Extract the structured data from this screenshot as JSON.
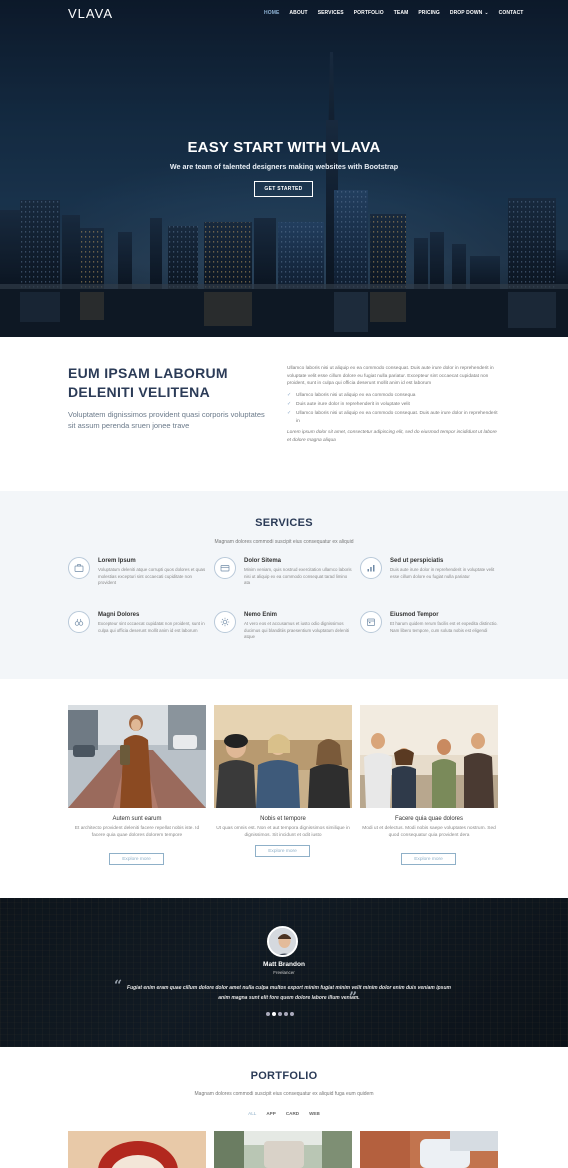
{
  "nav": {
    "logo": "VLAVA",
    "items": [
      "HOME",
      "ABOUT",
      "SERVICES",
      "PORTFOLIO",
      "TEAM",
      "PRICING",
      "DROP DOWN",
      "CONTACT"
    ],
    "active": "HOME"
  },
  "hero": {
    "title": "EASY START WITH VLAVA",
    "subtitle": "We are team of talented designers making websites with Bootstrap",
    "button": "GET STARTED"
  },
  "about": {
    "title": "EUM IPSAM LABORUM DELENITI VELITENA",
    "lead": "Voluptatem dignissimos provident quasi corporis voluptates sit assum perenda sruen jonee trave",
    "paragraph": "Ullamco laboris nisi ut aliquip ex ea commodo consequat. Duis aute irure dolor in reprehenderit in voluptate velit esse cillum dolore eu fugiat nulla pariatur. Excepteur sint occaecat cupidatat non proident, sunt in culpa qui officia deserunt mollit anim id est laborum",
    "checklist": [
      "Ullamco laboris nisi ut aliquip ex ea commodo consequa",
      "Duis aute irure dolor in reprehenderit in voluptate velit",
      "Ullamco laboris nisi ut aliquip ex ea commodo consequat. Duis aute irure dolor in reprehenderit in"
    ],
    "italic": "Lorem ipsum dolor sit amet, consectetur adipiscing elit, sed do eiusmod tempor incididunt ut labore et dolore magna aliqua"
  },
  "services": {
    "title": "SERVICES",
    "subtitle": "Magnam dolores commodi suscipit eius consequatur ex aliquid",
    "items": [
      {
        "name": "Lorem Ipsum",
        "desc": "Voluptatum deleniti atque corrupti quos dolores et quas molestias excepturi sint occaecati cupiditate non provident",
        "icon": "briefcase-icon"
      },
      {
        "name": "Dolor Sitema",
        "desc": "Minim veniam, quis nostrud exercitation ullamco laboris nisi ut aliquip ex ea commodo consequat tarad limino ata",
        "icon": "card-icon"
      },
      {
        "name": "Sed ut perspiciatis",
        "desc": "Duis aute irure dolor in reprehenderit in voluptate velit esse cillum dolore eu fugiat nulla pariatur",
        "icon": "bar-chart-icon"
      },
      {
        "name": "Magni Dolores",
        "desc": "Excepteur sint occaecat cupidatat non proident, sunt in culpa qui officia deserunt mollit anim id est laborum",
        "icon": "binoculars-icon"
      },
      {
        "name": "Nemo Enim",
        "desc": "At vero eos et accusamus et iusto odio dignissimos ducimus qui blanditiis praesentium voluptatum deleniti atque",
        "icon": "sun-icon"
      },
      {
        "name": "Eiusmod Tempor",
        "desc": "Et harum quidem rerum facilis est et expedita distinctio. Nam libero tempore, cum soluta nobis est eligendi",
        "icon": "calendar-icon"
      }
    ]
  },
  "cards": [
    {
      "title": "Autem sunt earum",
      "desc": "Et architecto provident deleniti facere repellat nobis iste. Id facere quia quae dolores dolorem tempore",
      "button": "Explore more"
    },
    {
      "title": "Nobis et tempore",
      "desc": "Ut quas omnis est. Non et aut tempora dignissimos similique in dignissimos. Sit incidunt et odit iusto",
      "button": "Explore more"
    },
    {
      "title": "Facere quia quae dolores",
      "desc": "Modi ut et delectus. Modi nobis saepe voluptates nostrum. Sed quod consequatur quia provident dera",
      "button": "Explore more"
    }
  ],
  "testimonial": {
    "name": "Matt Brandon",
    "role": "Freelancer",
    "quote": "Fugiat enim eram quae cillum dolore dolor amet nulla culpa multos export minim fugiat minim velit minim dolor enim duis veniam ipsum anim magna sunt elit fore quem dolore labore illum veniam.",
    "dots": 5,
    "active_dot": 1
  },
  "portfolio": {
    "title": "PORTFOLIO",
    "subtitle": "Magnam dolores commodi suscipit eius consequatur ex aliquid fuga eum quidem",
    "filters": [
      "ALL",
      "APP",
      "CARD",
      "WEB"
    ],
    "active_filter": "ALL"
  },
  "colors": {
    "heading": "#2b3b57",
    "accent": "#8fb0c8",
    "services_bg": "#f3f6f9"
  }
}
